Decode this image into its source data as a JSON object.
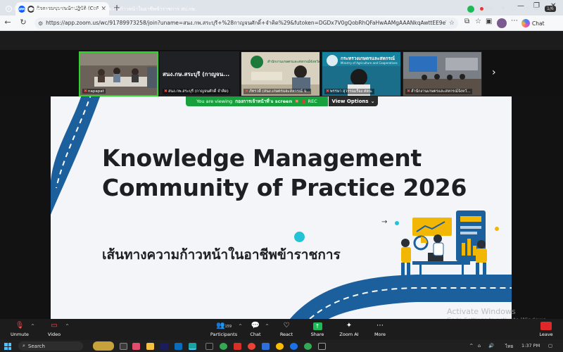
{
  "browser": {
    "tab_title": "กิจกรรมชุมชนนักปฏิบัติ (CoP) เรื่อง",
    "tab_close": "✕",
    "new_tab": "+",
    "window_controls": [
      "—",
      "❐",
      "✕"
    ],
    "url": "https://app.zoom.us/wc/91789973258/join?uname=สนง.กพ.สระบุรี+%28กาญจนศักดิ์+จำคิด%29&futoken=DGDx7V0gQobRhQFaHwAAMgAAANkqAwttEE9eVw-P0f8R2…",
    "chat_label": "Chat"
  },
  "meeting": {
    "title": "กิจกรรมชุมชนนักปฏิบัติ (CoP) เรื่อง เส้นทางความก้าวหน้าในอาชีพข้าราชการ สป.กษ.",
    "rec_label": "REC",
    "gallery_nav": "1/6"
  },
  "gallery": [
    {
      "name": "napapat"
    },
    {
      "name": "สนง.กพ.สระบุรี (กาญจนศักดิ์ จำคิด)",
      "overlay": "สนง.กษ.สระบุรี (กาญจน..."
    },
    {
      "name": "ภัทรวดี (สนง.เกษตรและสหกรณ์ จ...",
      "org": "สำนักงานเกษตรและสหกรณ์จังหวัด"
    },
    {
      "name": "พรรษา สุวรรณเรือง ศตน.",
      "org": "กระทรวงเกษตรและสหกรณ์",
      "org_en": "Ministry of Agriculture and Cooperatives"
    },
    {
      "name": "สำนักงานเกษตรและสหกรณ์จังหวั..."
    }
  ],
  "share": {
    "viewing_prefix": "You are viewing",
    "viewing_name": "กองการเจ้าหน้าที่'s screen",
    "rec": "REC",
    "view_options": "View Options"
  },
  "slide": {
    "title_line1": "Knowledge Management",
    "title_line2": "Community of Practice 2026",
    "subtitle": "เส้นทางความก้าวหน้าในอาชีพข้าราชการ"
  },
  "watermark": {
    "line1": "Activate Windows",
    "line2": "Go to Settings to activate Windows."
  },
  "toolbar": {
    "unmute": "Unmute",
    "video": "Video",
    "participants": "Participants",
    "participants_count": "159",
    "chat": "Chat",
    "react": "React",
    "share": "Share",
    "zoom_ai": "Zoom AI",
    "more": "More",
    "leave": "Leave"
  },
  "taskbar": {
    "search": "Search",
    "lang": "ไทย",
    "time": "1:37 PM"
  },
  "colors": {
    "zoom_blue": "#0b5cff",
    "share_green": "#17a03c",
    "slide_navy": "#1c5f9d",
    "accent_yellow": "#f2b705",
    "accent_cyan": "#22c3d6"
  }
}
